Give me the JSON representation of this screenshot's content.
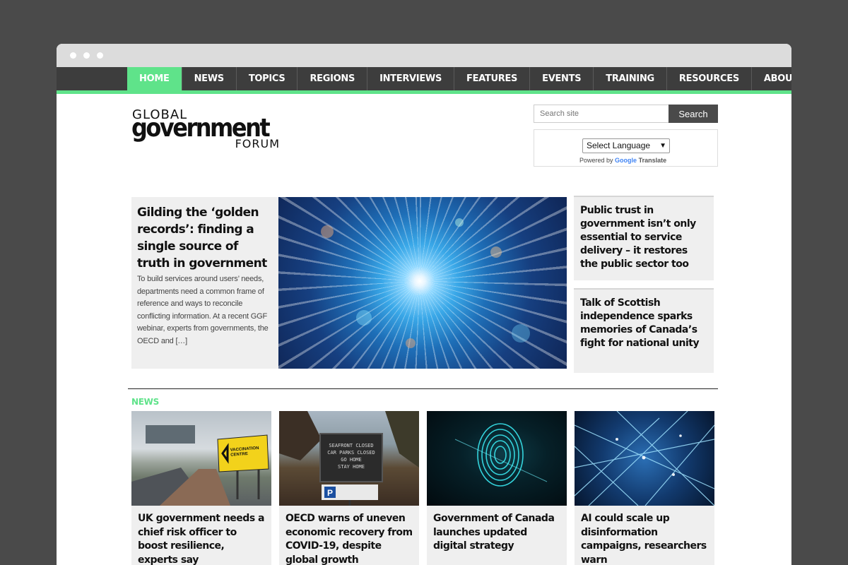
{
  "nav": {
    "items": [
      "HOME",
      "NEWS",
      "TOPICS",
      "REGIONS",
      "INTERVIEWS",
      "FEATURES",
      "EVENTS",
      "TRAINING",
      "RESOURCES",
      "ABOUT"
    ],
    "active": "HOME"
  },
  "logo": {
    "line1": "GLOBAL",
    "line2": "government",
    "line3": "FORUM"
  },
  "search": {
    "placeholder": "Search site",
    "button": "Search"
  },
  "translate": {
    "select_label": "Select Language",
    "powered_by": "Powered by",
    "google": "Google",
    "translate": "Translate"
  },
  "feature": {
    "title": "Gilding the ‘golden records’: finding a single source of truth in government",
    "excerpt": "To build services around users’ needs, departments need a common frame of reference and ways to reconcile conflicting information. At a recent GGF webinar, experts from governments, the OECD and […]"
  },
  "side_stories": [
    "Public trust in government isn’t only essential to service delivery – it restores the public sector too",
    "Talk of Scottish independence sparks memories of Canada’s fight for national unity"
  ],
  "news": {
    "section_label": "NEWS",
    "items": [
      "UK government needs a chief risk officer to boost resilience, experts say",
      "OECD warns of uneven economic recovery from COVID-19, despite global growth",
      "Government of Canada launches updated digital strategy",
      "AI could scale up disinformation campaigns, researchers warn"
    ],
    "image_texts": {
      "vaccination_sign": "VACCINATION CENTRE",
      "seafront_sign": [
        "SEAFRONT CLOSED",
        "CAR PARKS CLOSED",
        "GO HOME",
        "STAY HOME"
      ]
    }
  },
  "colors": {
    "accent": "#5fe38a",
    "nav_bg": "#3d3d3d",
    "card_bg": "#efefef",
    "frame_bg": "#4a4a4a"
  }
}
